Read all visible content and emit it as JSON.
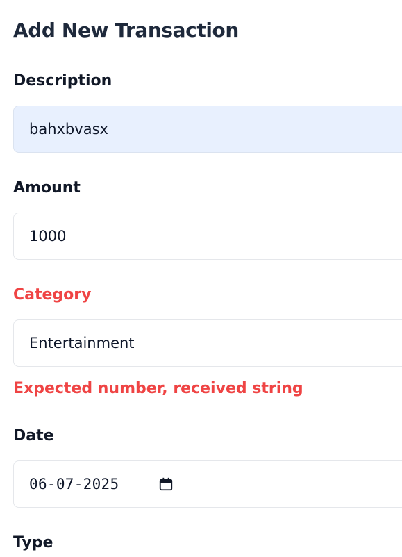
{
  "form": {
    "title": "Add New Transaction",
    "description": {
      "label": "Description",
      "value": "bahxbvasx"
    },
    "amount": {
      "label": "Amount",
      "value": "1000"
    },
    "category": {
      "label": "Category",
      "value": "Entertainment",
      "error": "Expected number, received string"
    },
    "date": {
      "label": "Date",
      "value": "06-07-2025",
      "icon": "calendar-icon"
    },
    "type": {
      "label": "Type"
    }
  },
  "colors": {
    "error": "#ef4444",
    "autofill_bg": "#e8f0fe",
    "title": "#1e293b"
  }
}
